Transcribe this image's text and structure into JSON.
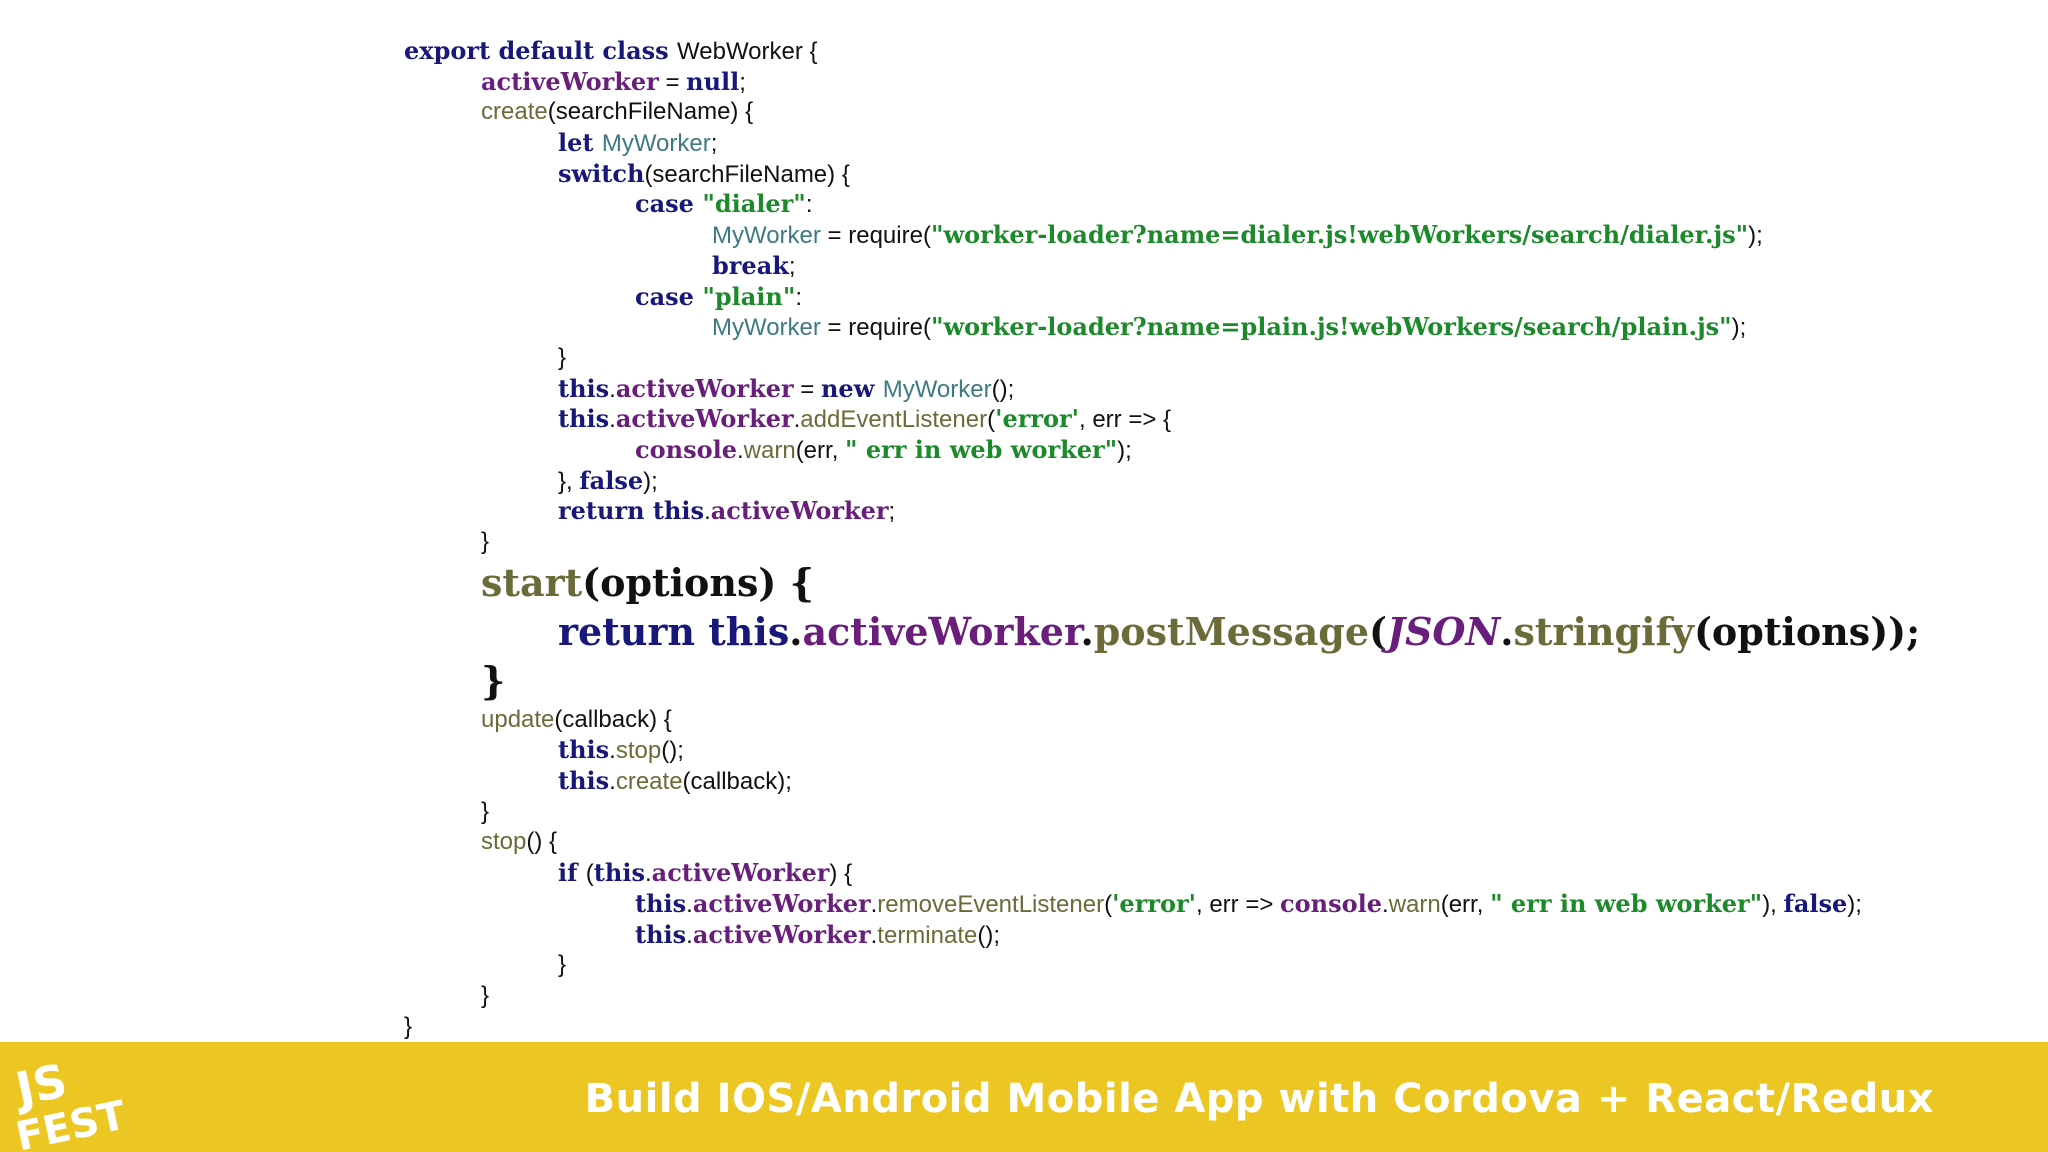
{
  "code": {
    "lines": [
      {
        "indent": 0,
        "tokens": [
          [
            "k",
            "export default class "
          ],
          [
            "t",
            "WebWorker {"
          ]
        ]
      },
      {
        "indent": 1,
        "tokens": [
          [
            "p",
            "activeWorker"
          ],
          [
            "t",
            " = "
          ],
          [
            "k",
            "null"
          ],
          [
            "t",
            ";"
          ]
        ]
      },
      {
        "indent": 1,
        "tokens": [
          [
            "m",
            "create"
          ],
          [
            "t",
            "(searchFileName) {"
          ]
        ]
      },
      {
        "indent": 2,
        "tokens": [
          [
            "k",
            "let "
          ],
          [
            "c",
            "MyWorker"
          ],
          [
            "t",
            ";"
          ]
        ]
      },
      {
        "indent": 2,
        "tokens": [
          [
            "k",
            "switch"
          ],
          [
            "t",
            "(searchFileName) {"
          ]
        ]
      },
      {
        "indent": 3,
        "tokens": [
          [
            "k",
            "case "
          ],
          [
            "s",
            "\"dialer\""
          ],
          [
            "t",
            ":"
          ]
        ]
      },
      {
        "indent": 4,
        "tokens": [
          [
            "c",
            "MyWorker"
          ],
          [
            "t",
            " = require("
          ],
          [
            "s",
            "\"worker-loader?name=dialer.js!webWorkers/search/dialer.js\""
          ],
          [
            "t",
            ");"
          ]
        ]
      },
      {
        "indent": 4,
        "tokens": [
          [
            "k",
            "break"
          ],
          [
            "t",
            ";"
          ]
        ]
      },
      {
        "indent": 3,
        "tokens": [
          [
            "k",
            "case "
          ],
          [
            "s",
            "\"plain\""
          ],
          [
            "t",
            ":"
          ]
        ]
      },
      {
        "indent": 4,
        "tokens": [
          [
            "c",
            "MyWorker"
          ],
          [
            "t",
            " = require("
          ],
          [
            "s",
            "\"worker-loader?name=plain.js!webWorkers/search/plain.js\""
          ],
          [
            "t",
            ");"
          ]
        ]
      },
      {
        "indent": 2,
        "tokens": [
          [
            "t",
            "}"
          ]
        ]
      },
      {
        "indent": 2,
        "tokens": [
          [
            "k",
            "this"
          ],
          [
            "t",
            "."
          ],
          [
            "p",
            "activeWorker"
          ],
          [
            "t",
            " = "
          ],
          [
            "k",
            "new "
          ],
          [
            "c",
            "MyWorker"
          ],
          [
            "t",
            "();"
          ]
        ]
      },
      {
        "indent": 2,
        "tokens": [
          [
            "k",
            "this"
          ],
          [
            "t",
            "."
          ],
          [
            "p",
            "activeWorker"
          ],
          [
            "t",
            "."
          ],
          [
            "m",
            "addEventListener"
          ],
          [
            "t",
            "("
          ],
          [
            "s",
            "'error'"
          ],
          [
            "t",
            ", err => {"
          ]
        ]
      },
      {
        "indent": 3,
        "tokens": [
          [
            "p",
            "console"
          ],
          [
            "t",
            "."
          ],
          [
            "m",
            "warn"
          ],
          [
            "t",
            "(err, "
          ],
          [
            "s",
            "\" err in web worker\""
          ],
          [
            "t",
            ");"
          ]
        ]
      },
      {
        "indent": 2,
        "tokens": [
          [
            "t",
            "}, "
          ],
          [
            "k",
            "false"
          ],
          [
            "t",
            ");"
          ]
        ]
      },
      {
        "indent": 2,
        "tokens": [
          [
            "k",
            "return this"
          ],
          [
            "t",
            "."
          ],
          [
            "p",
            "activeWorker"
          ],
          [
            "t",
            ";"
          ]
        ]
      },
      {
        "indent": 1,
        "tokens": [
          [
            "t",
            "}"
          ]
        ]
      },
      {
        "indent": 1,
        "big": true,
        "tokens": [
          [
            "m",
            "start"
          ],
          [
            "tb",
            "(options) {"
          ]
        ]
      },
      {
        "indent": 2,
        "big": true,
        "tokens": [
          [
            "k",
            "return this"
          ],
          [
            "tb",
            "."
          ],
          [
            "p",
            "activeWorker"
          ],
          [
            "tb",
            "."
          ],
          [
            "m",
            "postMessage"
          ],
          [
            "tb",
            "("
          ],
          [
            "g",
            "JSON"
          ],
          [
            "tb",
            "."
          ],
          [
            "m",
            "stringify"
          ],
          [
            "tb",
            "(options));"
          ]
        ]
      },
      {
        "indent": 1,
        "big": true,
        "tokens": [
          [
            "tb",
            "}"
          ]
        ]
      },
      {
        "indent": 1,
        "tokens": [
          [
            "m",
            "update"
          ],
          [
            "t",
            "(callback) {"
          ]
        ]
      },
      {
        "indent": 2,
        "tokens": [
          [
            "k",
            "this"
          ],
          [
            "t",
            "."
          ],
          [
            "m",
            "stop"
          ],
          [
            "t",
            "();"
          ]
        ]
      },
      {
        "indent": 2,
        "tokens": [
          [
            "k",
            "this"
          ],
          [
            "t",
            "."
          ],
          [
            "m",
            "create"
          ],
          [
            "t",
            "(callback);"
          ]
        ]
      },
      {
        "indent": 1,
        "tokens": [
          [
            "t",
            "}"
          ]
        ]
      },
      {
        "indent": 1,
        "tokens": [
          [
            "m",
            "stop"
          ],
          [
            "t",
            "() {"
          ]
        ]
      },
      {
        "indent": 2,
        "tokens": [
          [
            "k",
            "if "
          ],
          [
            "t",
            "("
          ],
          [
            "k",
            "this"
          ],
          [
            "t",
            "."
          ],
          [
            "p",
            "activeWorker"
          ],
          [
            "t",
            ") {"
          ]
        ]
      },
      {
        "indent": 3,
        "tokens": [
          [
            "k",
            "this"
          ],
          [
            "t",
            "."
          ],
          [
            "p",
            "activeWorker"
          ],
          [
            "t",
            "."
          ],
          [
            "m",
            "removeEventListener"
          ],
          [
            "t",
            "("
          ],
          [
            "s",
            "'error'"
          ],
          [
            "t",
            ", err => "
          ],
          [
            "p",
            "console"
          ],
          [
            "t",
            "."
          ],
          [
            "m",
            "warn"
          ],
          [
            "t",
            "(err, "
          ],
          [
            "s",
            "\" err in web worker\""
          ],
          [
            "t",
            "), "
          ],
          [
            "k",
            "false"
          ],
          [
            "t",
            ");"
          ]
        ]
      },
      {
        "indent": 3,
        "tokens": [
          [
            "k",
            "this"
          ],
          [
            "t",
            "."
          ],
          [
            "p",
            "activeWorker"
          ],
          [
            "t",
            "."
          ],
          [
            "m",
            "terminate"
          ],
          [
            "t",
            "();"
          ]
        ]
      },
      {
        "indent": 2,
        "tokens": [
          [
            "t",
            "}"
          ]
        ]
      },
      {
        "indent": 1,
        "tokens": [
          [
            "t",
            "}"
          ]
        ]
      },
      {
        "indent": 0,
        "tokens": [
          [
            "t",
            "}"
          ]
        ]
      }
    ]
  },
  "footer": {
    "title": "Build IOS/Android Mobile App with Cordova + React/Redux",
    "logo_line1": "JS",
    "logo_line2": "FEST",
    "background": "#ecc623"
  }
}
